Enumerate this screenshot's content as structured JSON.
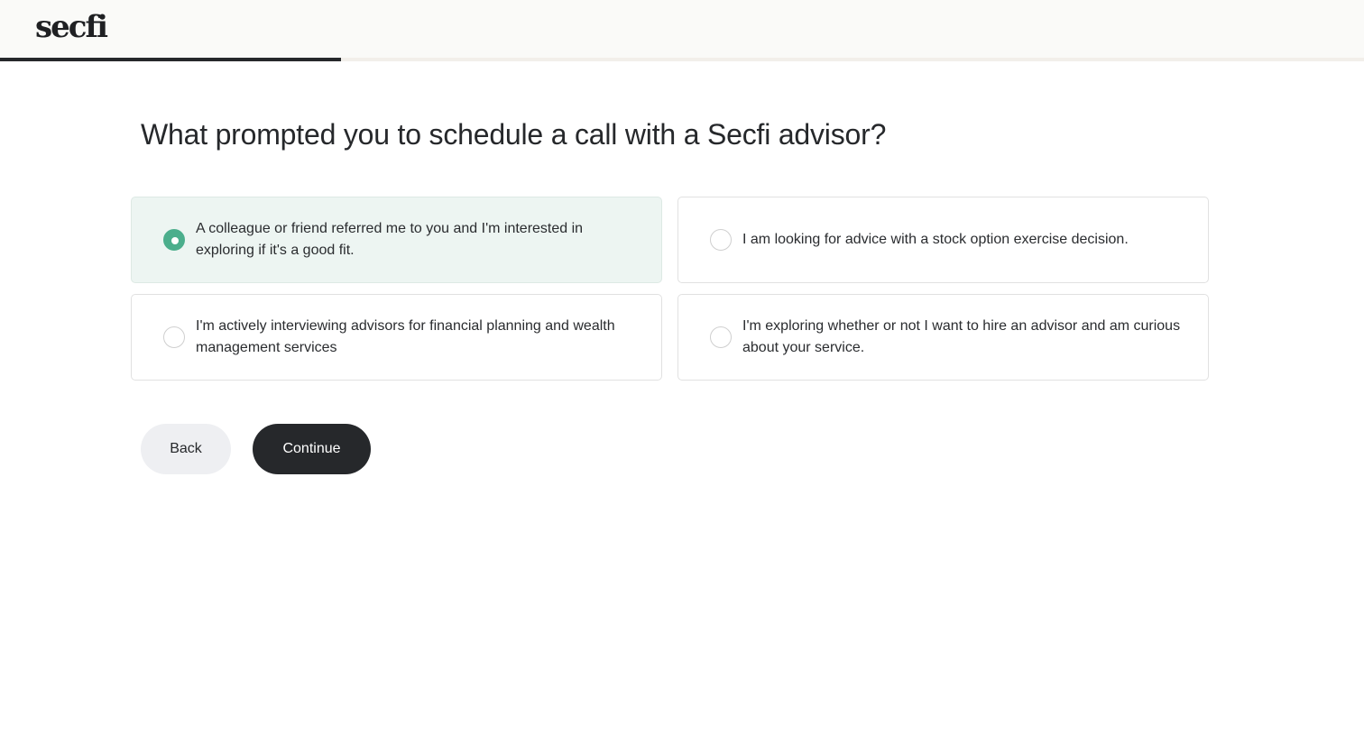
{
  "header": {
    "logo_text": "secfi"
  },
  "progress": {
    "fraction": 0.25
  },
  "question": {
    "title": "What prompted you to schedule a call with a Secfi advisor?"
  },
  "options": [
    {
      "label": "A colleague or friend referred me to you and I'm interested in exploring if it's a good fit.",
      "selected": true
    },
    {
      "label": "I am looking for advice with a stock option exercise decision.",
      "selected": false
    },
    {
      "label": "I'm actively interviewing advisors for financial planning and wealth management services",
      "selected": false
    },
    {
      "label": "I'm exploring whether or not I want to hire an advisor and am curious about your service.",
      "selected": false
    }
  ],
  "buttons": {
    "back_label": "Back",
    "continue_label": "Continue"
  },
  "colors": {
    "accent": "#4bae8c",
    "selected_background": "#edf5f2",
    "dark": "#26282b",
    "secondary_button": "#eeeff2"
  }
}
